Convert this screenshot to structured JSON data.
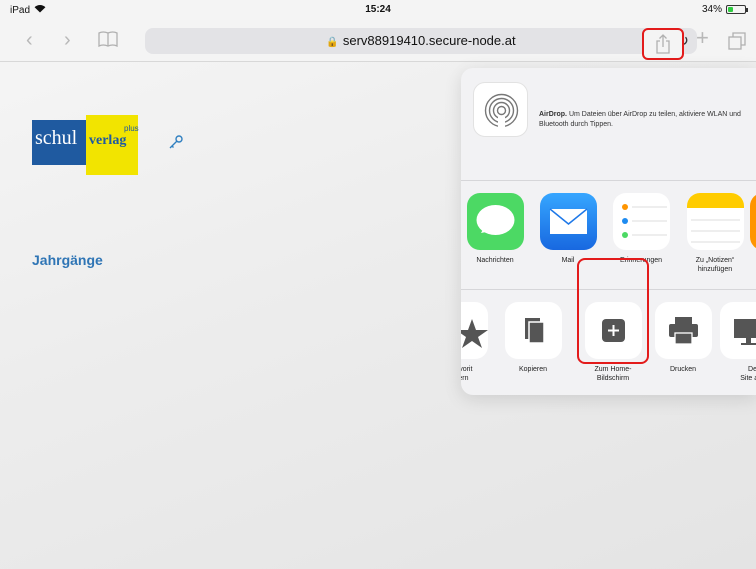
{
  "status_bar": {
    "device": "iPad",
    "time": "15:24",
    "battery": "34%",
    "battery_level": 0.34
  },
  "toolbar": {
    "url": "serv88919410.secure-node.at"
  },
  "page": {
    "logo": {
      "schul": "schul",
      "verlag": "verlag",
      "plus": "plus"
    },
    "section_title": "Jahrgänge"
  },
  "share_sheet": {
    "airdrop": {
      "title": "AirDrop.",
      "description": "Um Dateien über AirDrop zu teilen, aktiviere WLAN und Bluetooth durch Tippen."
    },
    "apps": [
      {
        "label": "Nachrichten",
        "icon": "messages-icon",
        "color": "#4cd964"
      },
      {
        "label": "Mail",
        "icon": "mail-icon",
        "color": "#1e8bf0"
      },
      {
        "label": "Erinnerungen",
        "icon": "reminders-icon",
        "color": "#ffffff"
      },
      {
        "label": "Zu „Notizen“ hinzufügen",
        "icon": "notes-icon",
        "color": "#ffffff"
      }
    ],
    "actions": [
      {
        "label": "s Favorit\nichern",
        "icon": "star-icon"
      },
      {
        "label": "Kopieren",
        "icon": "copy-icon"
      },
      {
        "label": "Zum Home-\nBildschirm",
        "icon": "add-home-icon"
      },
      {
        "label": "Drucken",
        "icon": "print-icon"
      },
      {
        "label": "Desk\nSite anf",
        "icon": "desktop-icon"
      }
    ]
  },
  "colors": {
    "accent_blue": "#2f75b5",
    "highlight_red": "#e31b1b"
  }
}
